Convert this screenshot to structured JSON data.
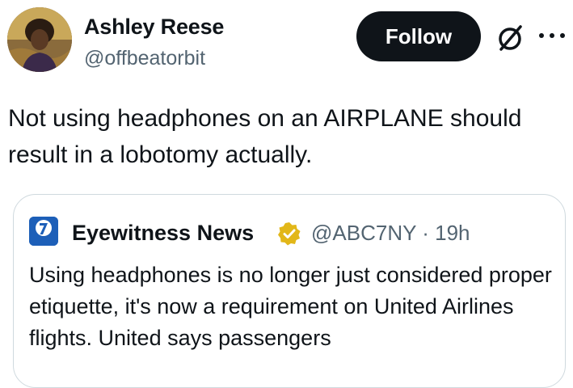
{
  "author": {
    "name": "Ashley Reese",
    "handle": "@offbeatorbit"
  },
  "actions": {
    "follow_label": "Follow"
  },
  "tweet": {
    "text": "Not using headphones on an AIRPLANE should result in a lobotomy actually."
  },
  "quote": {
    "logo_text": "abc7NY",
    "name": "Eyewitness News",
    "handle": "@ABC7NY",
    "separator": "·",
    "time": "19h",
    "text": "Using headphones is no longer just considered proper etiquette, it's now a requirement on United Airlines flights. United says passengers"
  },
  "colors": {
    "follow_bg": "#0f1419",
    "muted": "#536471",
    "verified_gold": "#e2b719",
    "card_border": "#cfd9de",
    "abc_blue": "#1d5fb8"
  },
  "icons": {
    "grok": "grok-icon",
    "more": "more-options-icon",
    "verified": "verified-badge-icon"
  }
}
